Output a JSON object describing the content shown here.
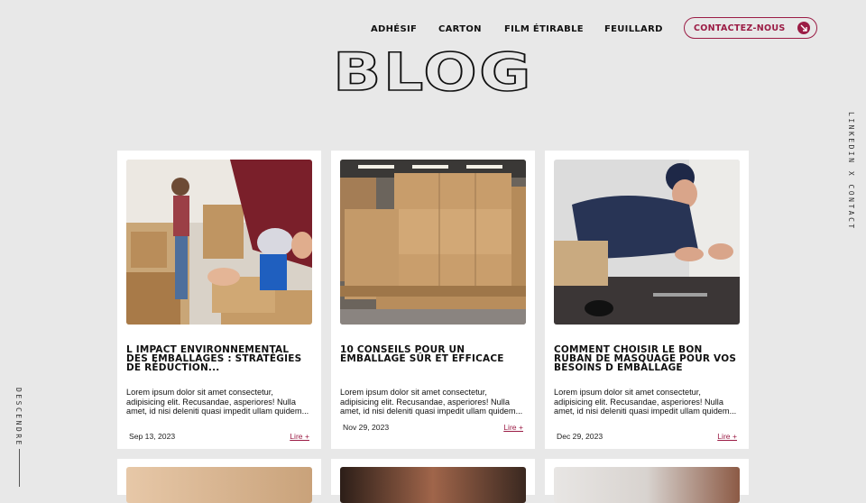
{
  "nav": {
    "links": [
      "ADHÉSIF",
      "CARTON",
      "FILM ÉTIRABLE",
      "FEUILLARD"
    ],
    "contact_label": "CONTACTEZ-NOUS"
  },
  "page_title": "BLOG",
  "side": {
    "right_text": "LINKEDIN X CONTACT",
    "left_text": "DESCENDRE"
  },
  "posts": [
    {
      "title": "L IMPACT ENVIRONNEMENTAL DES EMBALLAGES : STRATÉGIES DE RÉDUCTION...",
      "excerpt": "Lorem ipsum dolor sit amet consectetur, adipisicing elit. Recusandae, asperiores! Nulla amet, id nisi deleniti quasi impedit ullam quidem...",
      "date": "Sep 13, 2023",
      "more": "Lire +",
      "image": "person-taping-cardboard-box-photo"
    },
    {
      "title": "10 CONSEILS POUR UN EMBALLAGE SÛR ET EFFICACE",
      "excerpt": "Lorem ipsum dolor sit amet consectetur, adipisicing elit. Recusandae, asperiores! Nulla amet, id nisi deleniti quasi impedit ullam quidem...",
      "date": "Nov 29, 2023",
      "more": "Lire +",
      "image": "pallet-of-wrapped-boxes-photo"
    },
    {
      "title": "COMMENT CHOISIR LE BON RUBAN DE MASQUAGE POUR VOS BESOINS D EMBALLAGE",
      "excerpt": "Lorem ipsum dolor sit amet consectetur, adipisicing elit. Recusandae, asperiores! Nulla amet, id nisi deleniti quasi impedit ullam quidem...",
      "date": "Dec 29, 2023",
      "more": "Lire +",
      "image": "worker-with-masking-tape-photo"
    }
  ],
  "colors": {
    "accent": "#9b1c45",
    "background": "#e8e8e8",
    "card": "#ffffff"
  }
}
